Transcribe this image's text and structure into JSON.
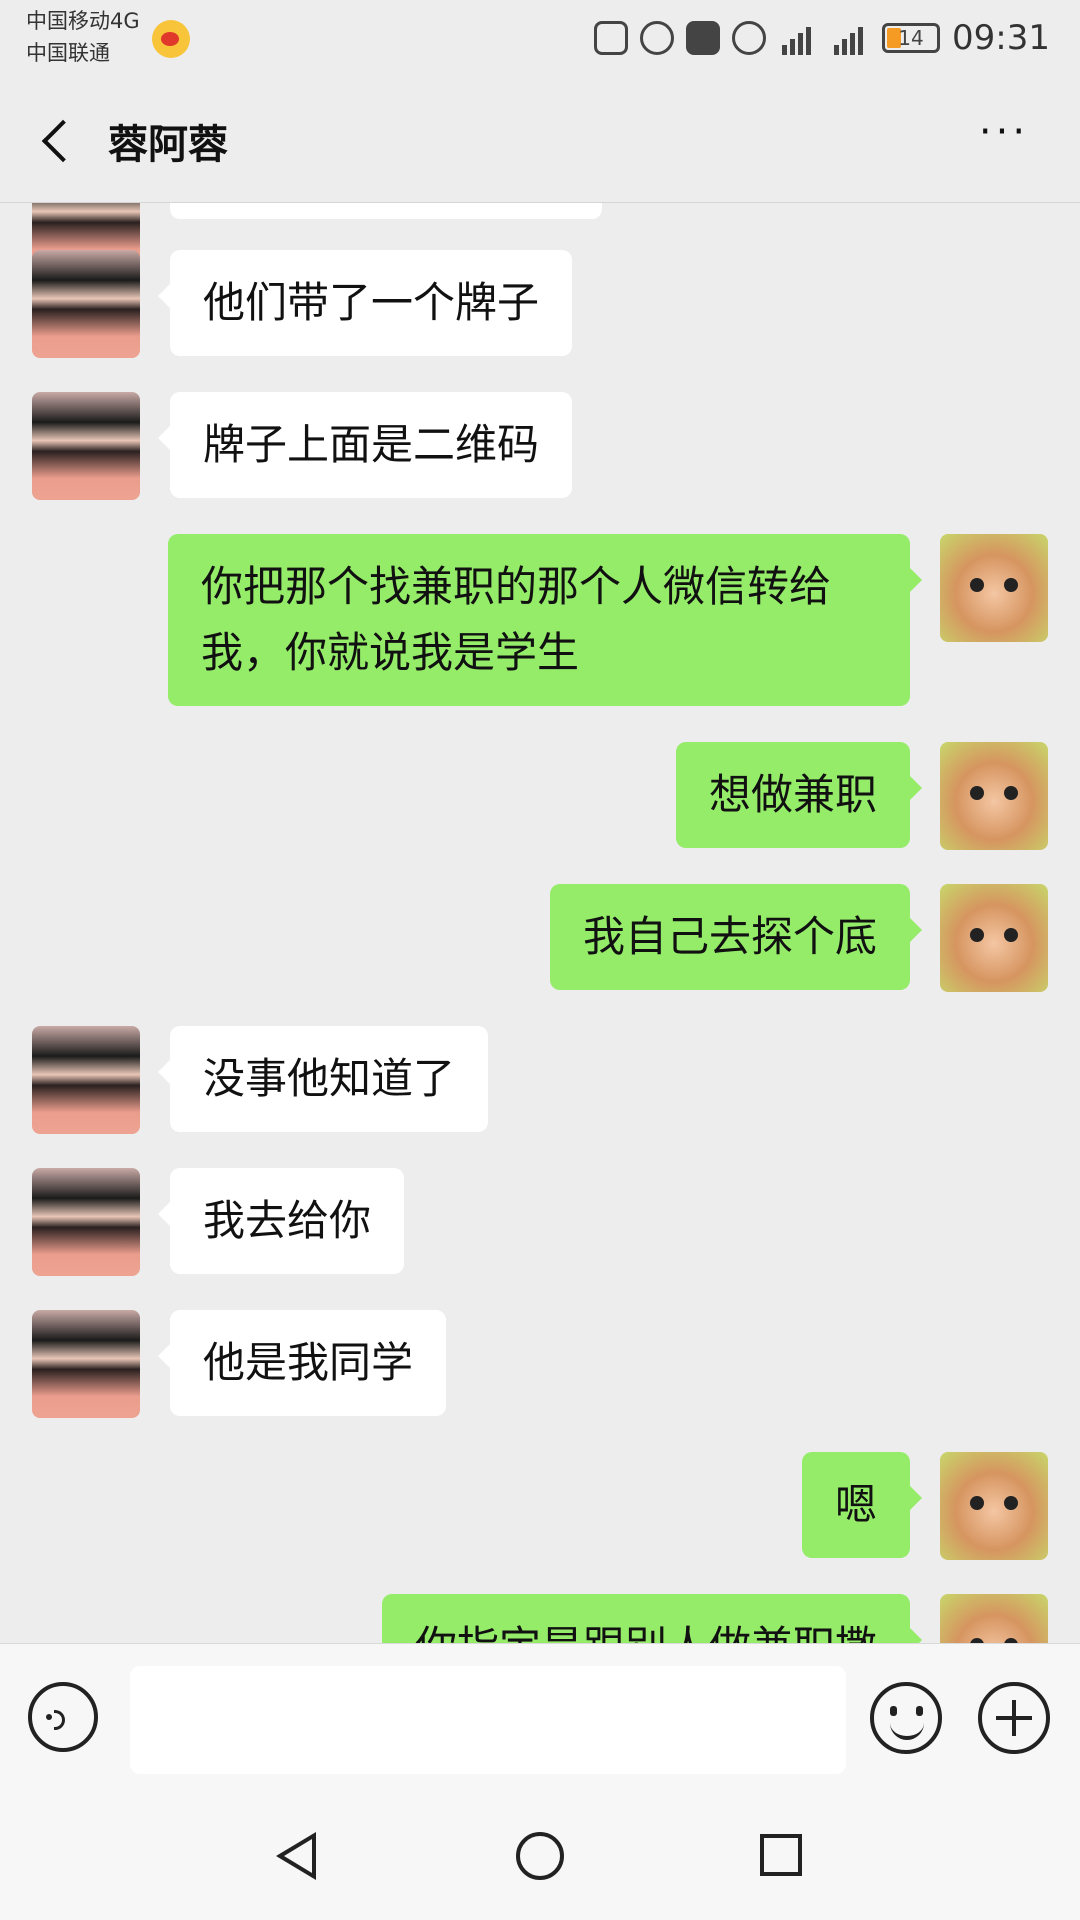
{
  "status_bar": {
    "carrier1": "中国移动4G",
    "carrier2": "中国联通",
    "battery": "14",
    "time": "09:31",
    "icons": [
      "weibo-icon",
      "vibrate-icon",
      "alarm-icon",
      "hd-icon",
      "eye-icon",
      "signal-4g-icon",
      "signal-g-icon",
      "battery-icon"
    ]
  },
  "header": {
    "title": "蓉阿蓉",
    "more": "···"
  },
  "messages": [
    {
      "side": "in",
      "text": "他们带了一个牌子"
    },
    {
      "side": "in",
      "text": "牌子上面是二维码"
    },
    {
      "side": "out",
      "text": "你把那个找兼职的那个人微信转给我，你就说我是学生"
    },
    {
      "side": "out",
      "text": "想做兼职"
    },
    {
      "side": "out",
      "text": "我自己去探个底"
    },
    {
      "side": "in",
      "text": "没事他知道了"
    },
    {
      "side": "in",
      "text": "我去给你"
    },
    {
      "side": "in",
      "text": "他是我同学"
    },
    {
      "side": "out",
      "text": "嗯"
    },
    {
      "side": "out",
      "text": "你指定是跟别人做兼职撒"
    }
  ],
  "input": {
    "placeholder": ""
  },
  "colors": {
    "bg": "#ededed",
    "outgoing": "#95ec69",
    "incoming": "#ffffff"
  }
}
